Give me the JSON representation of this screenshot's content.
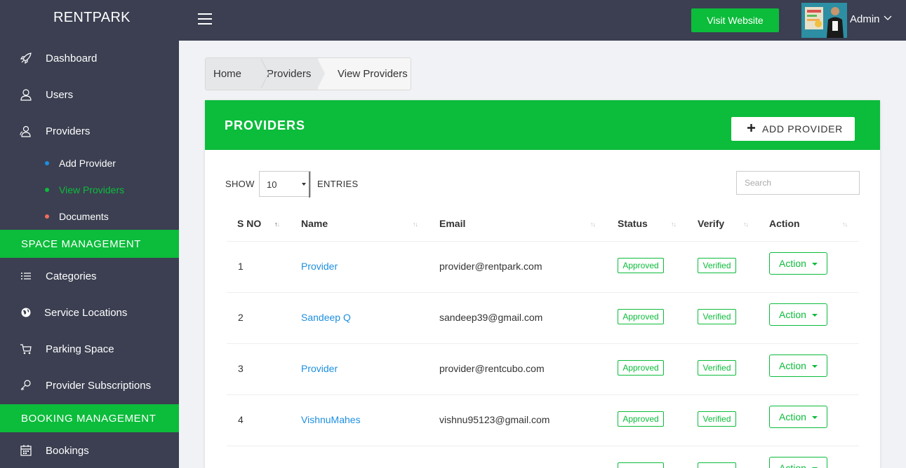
{
  "header": {
    "brand": "RENTPARK",
    "visit_website": "Visit Website",
    "admin_label": "Admin"
  },
  "sidebar": {
    "items": [
      {
        "label": "Dashboard",
        "icon": "rocket-icon"
      },
      {
        "label": "Users",
        "icon": "user-icon"
      },
      {
        "label": "Providers",
        "icon": "users-icon"
      }
    ],
    "sub_items": [
      {
        "label": "Add Provider",
        "dot_color": "#1d8fe0"
      },
      {
        "label": "View Providers",
        "dot_color": "#0cbc3b",
        "active": true
      },
      {
        "label": "Documents",
        "dot_color": "#f26d5b"
      }
    ],
    "space_management": {
      "heading": "SPACE MANAGEMENT",
      "items": [
        {
          "label": "Categories",
          "icon": "list-icon"
        },
        {
          "label": "Service Locations",
          "icon": "globe-icon"
        },
        {
          "label": "Parking Space",
          "icon": "cart-icon"
        },
        {
          "label": "Provider Subscriptions",
          "icon": "key-icon"
        }
      ]
    },
    "booking_management": {
      "heading": "BOOKING MANAGEMENT",
      "items": [
        {
          "label": "Bookings",
          "icon": "calendar-icon"
        }
      ]
    }
  },
  "breadcrumb": {
    "home": "Home",
    "providers": "Providers",
    "current": "View Providers"
  },
  "panel": {
    "title": "PROVIDERS",
    "add_button": "ADD PROVIDER",
    "show_label": "SHOW",
    "entries_value": "10",
    "entries_label": "ENTRIES",
    "search_placeholder": "Search"
  },
  "table": {
    "columns": [
      "S NO",
      "Name",
      "Email",
      "Status",
      "Verify",
      "Action"
    ],
    "rows": [
      {
        "sno": "1",
        "name": "Provider",
        "email": "provider@rentpark.com",
        "status": "Approved",
        "verify": "Verified",
        "action": "Action"
      },
      {
        "sno": "2",
        "name": "Sandeep Q",
        "email": "sandeep39@gmail.com",
        "status": "Approved",
        "verify": "Verified",
        "action": "Action"
      },
      {
        "sno": "3",
        "name": "Provider",
        "email": "provider@rentcubo.com",
        "status": "Approved",
        "verify": "Verified",
        "action": "Action"
      },
      {
        "sno": "4",
        "name": "VishnuMahes",
        "email": "vishnu95123@gmail.com",
        "status": "Approved",
        "verify": "Verified",
        "action": "Action"
      }
    ]
  },
  "colors": {
    "accent": "#0cbc3b",
    "sidebar": "#3b3f51",
    "link": "#1d8fe0"
  }
}
